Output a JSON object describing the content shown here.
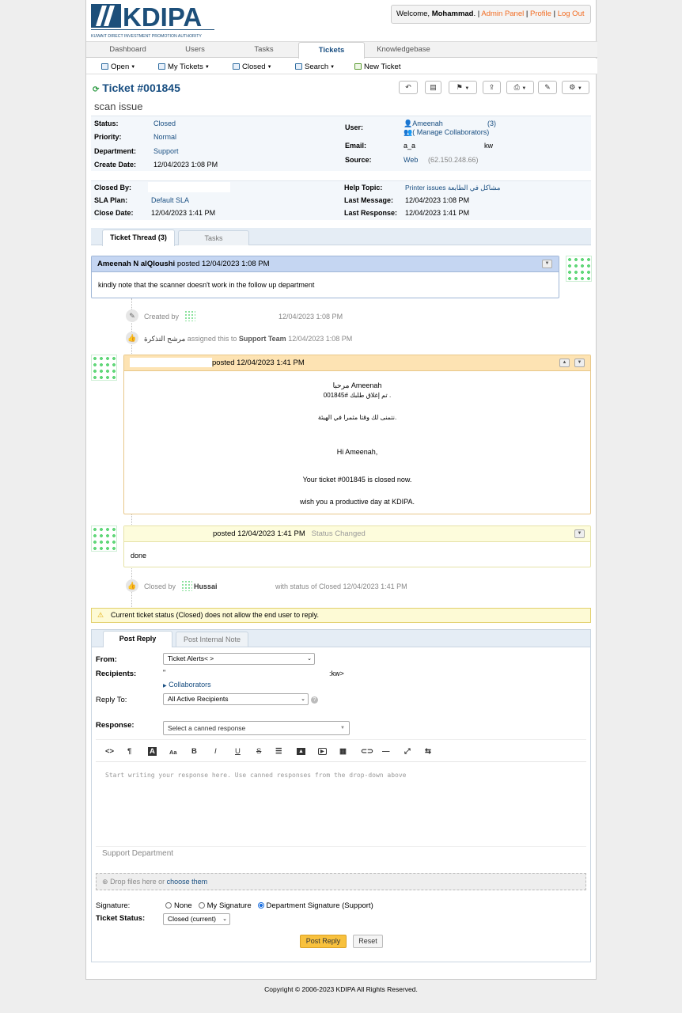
{
  "header": {
    "logo_text": "KDIPA",
    "logo_subtitle": "KUWAIT DIRECT INVESTMENT PROMOTION AUTHORITY",
    "welcome_prefix": "Welcome, ",
    "user_name": "Mohammad",
    "welcome_suffix": ". | ",
    "admin_panel": "Admin Panel",
    "sep1": " | ",
    "profile": "Profile",
    "sep2": " | ",
    "logout": "Log Out"
  },
  "nav": {
    "tabs": [
      {
        "label": "Dashboard"
      },
      {
        "label": "Users"
      },
      {
        "label": "Tasks"
      },
      {
        "label": "Tickets"
      },
      {
        "label": "Knowledgebase"
      }
    ],
    "active": "Tickets"
  },
  "subnav": {
    "open": "Open",
    "my_tickets": "My Tickets",
    "closed": "Closed",
    "search": "Search",
    "new_ticket": "New Ticket"
  },
  "ticket": {
    "number": "Ticket #001845",
    "subject": "scan issue",
    "status_label": "Status:",
    "status": "Closed",
    "priority_label": "Priority:",
    "priority": "Normal",
    "department_label": "Department:",
    "department": "Support",
    "create_date_label": "Create Date:",
    "create_date": "12/04/2023 1:08 PM",
    "user_label": "User:",
    "user": "Ameenah",
    "user_count": "(3)",
    "manage_collaborators": "( Manage Collaborators)",
    "email_label": "Email:",
    "email_a": "a_a",
    "email_b": "kw",
    "source_label": "Source:",
    "source": "Web",
    "source_ip": "(62.150.248.66)",
    "closed_by_label": "Closed By:",
    "sla_label": "SLA Plan:",
    "sla": "Default SLA",
    "close_date_label": "Close Date:",
    "close_date": "12/04/2023 1:41 PM",
    "help_topic_label": "Help Topic:",
    "help_topic": "Printer issues مشاكل في الطابعة",
    "last_message_label": "Last Message:",
    "last_message": "12/04/2023 1:08 PM",
    "last_response_label": "Last Response:",
    "last_response": "12/04/2023 1:41 PM"
  },
  "thread_tabs": [
    {
      "label": "Ticket Thread (3)"
    },
    {
      "label": "Tasks"
    }
  ],
  "thread": {
    "e1_author": "Ameenah N alQloushi",
    "e1_posted": " posted 12/04/2023 1:08 PM",
    "e1_body": "kindly note that the scanner doesn't work in the follow up department",
    "ev1_created": "Created by",
    "ev1_date": "12/04/2023 1:08 PM",
    "ev2_arabic": "مرشح التذكرة",
    "ev2_text": " assigned this to ",
    "ev2_team": "Support Team",
    "ev2_date": " 12/04/2023 1:08 PM",
    "e2_posted": "posted 12/04/2023 1:41 PM",
    "e2_l1": "مرحبا Ameenah",
    "e2_l2": "تم إغلاق طلبك #001845 .",
    "e2_l3": "نتمنى لك وقتا مثمرا في الهيئة.",
    "e2_l4": "Hi Ameenah,",
    "e2_l5": "Your ticket #001845 is closed now.",
    "e2_l6": "wish you a productive day at KDIPA.",
    "e3_posted": "posted 12/04/2023 1:41 PM",
    "e3_status": "Status Changed",
    "e3_body": "done",
    "ev3_closed": "Closed by",
    "ev3_name": "Hussai",
    "ev3_status": "with status of Closed 12/04/2023 1:41 PM"
  },
  "warning": "Current ticket status (Closed) does not allow the end user to reply.",
  "reply_tabs": [
    {
      "label": "Post Reply"
    },
    {
      "label": "Post Internal Note"
    }
  ],
  "reply": {
    "from_label": "From:",
    "from_value": "Ticket Alerts<                          >",
    "recipients_label": "Recipients:",
    "recipients_value": "\"",
    "recipients_end": ":kw>",
    "collaborators": "Collaborators",
    "reply_to_label": "Reply To:",
    "reply_to_value": "All Active Recipients",
    "response_label": "Response:",
    "response_placeholder": "Select a canned response",
    "editor_placeholder": "Start writing your response here. Use canned responses from the drop-down above",
    "signature_preview": "Support Department",
    "drop_text": "Drop files here or ",
    "choose": "choose them",
    "signature_label": "Signature:",
    "sig_none": "None",
    "sig_mine": "My Signature",
    "sig_dept": "Department Signature (Support)",
    "ticket_status_label": "Ticket Status:",
    "ticket_status_value": "Closed (current)",
    "post_button": "Post Reply",
    "reset_button": "Reset"
  },
  "footer": "Copyright © 2006-2023 KDIPA All Rights Reserved."
}
